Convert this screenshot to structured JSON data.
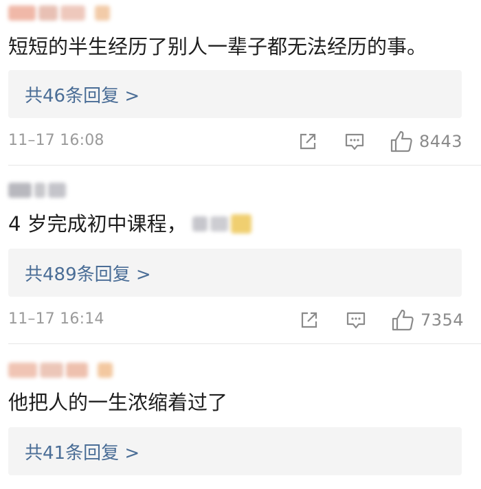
{
  "comments": [
    {
      "text": "短短的半生经历了别人一辈子都无法经历的事。",
      "reply_label": "共46条回复 >",
      "timestamp": "11–17 16:08",
      "likes": "8443"
    },
    {
      "text": "4 岁完成初中课程，",
      "reply_label": "共489条回复 >",
      "timestamp": "11–17 16:14",
      "likes": "7354"
    },
    {
      "text": "他把人的一生浓缩着过了",
      "reply_label": "共41条回复 >",
      "timestamp": "",
      "likes": ""
    }
  ],
  "icons": {
    "share": "share-icon",
    "comment": "comment-icon",
    "like": "thumbs-up-icon"
  },
  "colors": {
    "reply_link": "#4a6d96",
    "reply_bg": "#f4f4f4",
    "meta_text": "#9a9a9a",
    "icon_stroke": "#8a8a8a"
  }
}
